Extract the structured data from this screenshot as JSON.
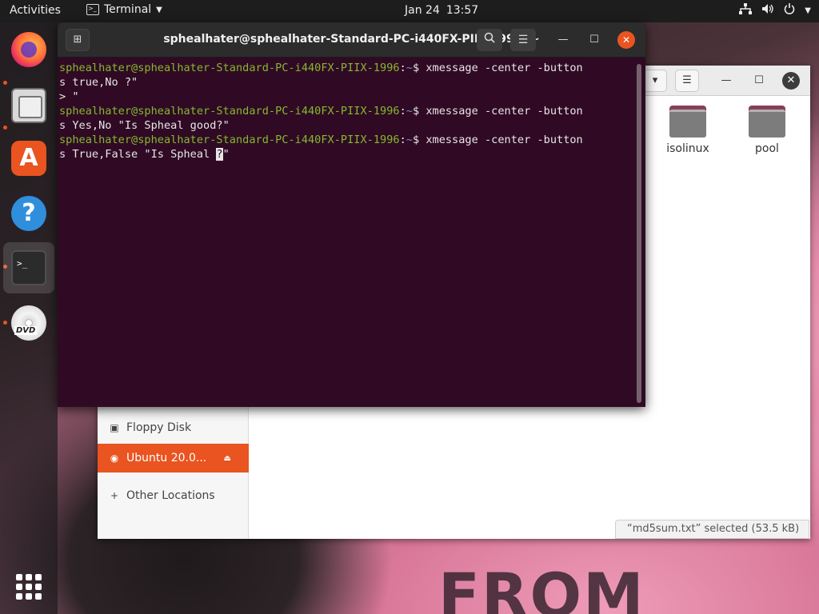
{
  "topbar": {
    "activities": "Activities",
    "app_name": "Terminal",
    "date": "Jan 24",
    "time": "13:57"
  },
  "dock": {
    "items": [
      {
        "name": "Firefox",
        "icon": "firefox-icon"
      },
      {
        "name": "Files",
        "icon": "files-icon"
      },
      {
        "name": "Ubuntu Software",
        "icon": "software-store-icon"
      },
      {
        "name": "Help",
        "icon": "help-icon"
      },
      {
        "name": "Terminal",
        "icon": "terminal-icon"
      },
      {
        "name": "DVD",
        "icon": "dvd-icon"
      }
    ],
    "dvd_label": "DVD",
    "accent_color": "#e95420"
  },
  "files": {
    "folders": [
      "isolinux",
      "pool"
    ],
    "sidebar": [
      {
        "label": "Floppy Disk"
      },
      {
        "label": "Ubuntu 20.0..."
      },
      {
        "label": "Other Locations"
      }
    ],
    "status": "“md5sum.txt” selected  (53.5 kB)"
  },
  "terminal": {
    "title": "sphealhater@sphealhater-Standard-PC-i440FX-PIIX-1996: ~",
    "background_color": "#300a24",
    "lines": [
      {
        "prompt": "sphealhater@sphealhater-Standard-PC-i440FX-PIIX-1996",
        "path": "~",
        "cmd": "$ xmessage -center -button"
      },
      {
        "text": "s true,No ?\""
      },
      {
        "text": "> \""
      },
      {
        "prompt": "sphealhater@sphealhater-Standard-PC-i440FX-PIIX-1996",
        "path": "~",
        "cmd": "$ xmessage -center -button"
      },
      {
        "text": "s Yes,No \"Is Spheal good?\""
      },
      {
        "prompt": "sphealhater@sphealhater-Standard-PC-i440FX-PIIX-1996",
        "path": "~",
        "cmd": "$ xmessage -center -button"
      },
      {
        "text_before_cursor": "s True,False \"Is Spheal ",
        "cursor_char": "?",
        "text_after_cursor": "\""
      }
    ]
  },
  "wallpaper_text": "FROM"
}
